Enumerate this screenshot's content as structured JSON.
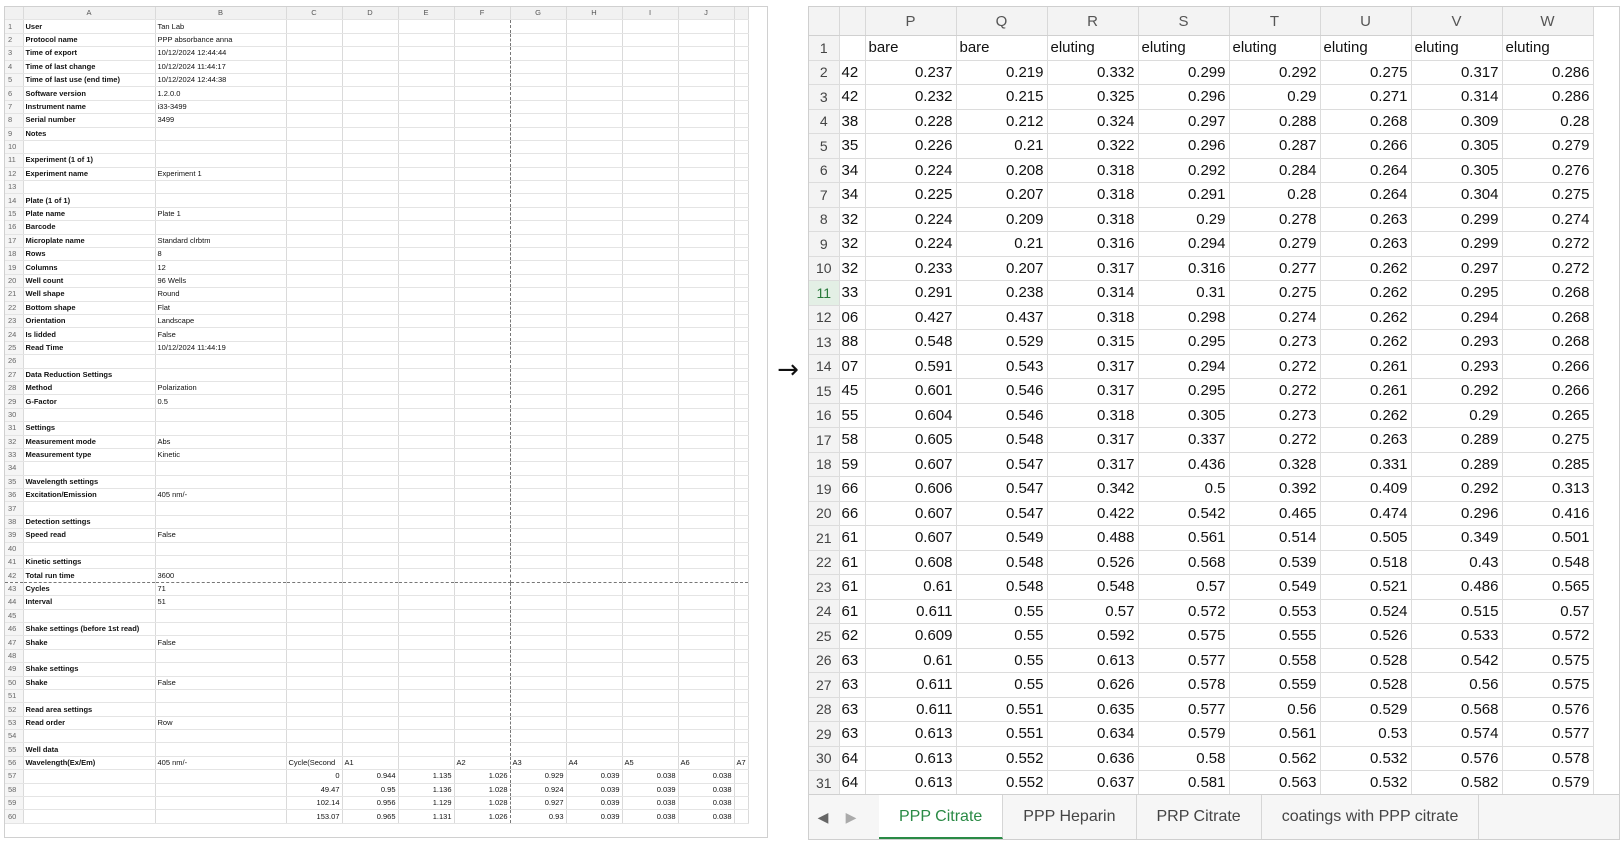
{
  "left_sheet": {
    "columns": [
      "A",
      "B",
      "C",
      "D",
      "E",
      "F",
      "G",
      "H",
      "I",
      "J"
    ],
    "rows": [
      {
        "n": "1",
        "a": "User",
        "b": "Tan Lab"
      },
      {
        "n": "2",
        "a": "Protocol name",
        "b": "PPP absorbance anna"
      },
      {
        "n": "3",
        "a": "Time of export",
        "b": "10/12/2024 12:44:44"
      },
      {
        "n": "4",
        "a": "Time of last change",
        "b": "10/12/2024 11:44:17"
      },
      {
        "n": "5",
        "a": "Time of last use (end time)",
        "b": "10/12/2024 12:44:38"
      },
      {
        "n": "6",
        "a": "Software version",
        "b": "1.2.0.0"
      },
      {
        "n": "7",
        "a": "Instrument name",
        "b": "i33-3499"
      },
      {
        "n": "8",
        "a": "Serial number",
        "b": "3499"
      },
      {
        "n": "9",
        "a": "Notes",
        "b": ""
      },
      {
        "n": "10",
        "a": "",
        "b": ""
      },
      {
        "n": "11",
        "a": "Experiment (1 of 1)",
        "b": ""
      },
      {
        "n": "12",
        "a": "Experiment name",
        "b": "Experiment 1"
      },
      {
        "n": "13",
        "a": "",
        "b": ""
      },
      {
        "n": "14",
        "a": "Plate (1 of 1)",
        "b": ""
      },
      {
        "n": "15",
        "a": "Plate name",
        "b": "Plate 1"
      },
      {
        "n": "16",
        "a": "Barcode",
        "b": ""
      },
      {
        "n": "17",
        "a": "Microplate name",
        "b": "Standard clrbtm"
      },
      {
        "n": "18",
        "a": "Rows",
        "b": "8"
      },
      {
        "n": "19",
        "a": "Columns",
        "b": "12"
      },
      {
        "n": "20",
        "a": "Well count",
        "b": "96 Wells"
      },
      {
        "n": "21",
        "a": "Well shape",
        "b": "Round"
      },
      {
        "n": "22",
        "a": "Bottom shape",
        "b": "Flat"
      },
      {
        "n": "23",
        "a": "Orientation",
        "b": "Landscape"
      },
      {
        "n": "24",
        "a": "Is lidded",
        "b": "False"
      },
      {
        "n": "25",
        "a": "Read Time",
        "b": "10/12/2024 11:44:19"
      },
      {
        "n": "26",
        "a": "",
        "b": ""
      },
      {
        "n": "27",
        "a": "Data Reduction Settings",
        "b": ""
      },
      {
        "n": "28",
        "a": "Method",
        "b": "Polarization"
      },
      {
        "n": "29",
        "a": "G-Factor",
        "b": "0.5"
      },
      {
        "n": "30",
        "a": "",
        "b": ""
      },
      {
        "n": "31",
        "a": "Settings",
        "b": ""
      },
      {
        "n": "32",
        "a": "Measurement mode",
        "b": "Abs"
      },
      {
        "n": "33",
        "a": "Measurement type",
        "b": "Kinetic"
      },
      {
        "n": "34",
        "a": "",
        "b": ""
      },
      {
        "n": "35",
        "a": "Wavelength settings",
        "b": ""
      },
      {
        "n": "36",
        "a": "Excitation/Emission",
        "b": "405 nm/-"
      },
      {
        "n": "37",
        "a": "",
        "b": ""
      },
      {
        "n": "38",
        "a": "Detection settings",
        "b": ""
      },
      {
        "n": "39",
        "a": "Speed read",
        "b": "False"
      },
      {
        "n": "40",
        "a": "",
        "b": ""
      },
      {
        "n": "41",
        "a": "Kinetic settings",
        "b": ""
      },
      {
        "n": "42",
        "a": "Total run time",
        "b": "3600"
      },
      {
        "n": "43",
        "a": "Cycles",
        "b": "71"
      },
      {
        "n": "44",
        "a": "Interval",
        "b": "51"
      },
      {
        "n": "45",
        "a": "",
        "b": ""
      },
      {
        "n": "46",
        "a": "Shake settings (before 1st read)",
        "b": ""
      },
      {
        "n": "47",
        "a": "Shake",
        "b": "False"
      },
      {
        "n": "48",
        "a": "",
        "b": ""
      },
      {
        "n": "49",
        "a": "Shake settings",
        "b": ""
      },
      {
        "n": "50",
        "a": "Shake",
        "b": "False"
      },
      {
        "n": "51",
        "a": "",
        "b": ""
      },
      {
        "n": "52",
        "a": "Read area settings",
        "b": ""
      },
      {
        "n": "53",
        "a": "Read order",
        "b": "Row"
      },
      {
        "n": "54",
        "a": "",
        "b": ""
      },
      {
        "n": "55",
        "a": "Well data",
        "b": ""
      },
      {
        "n": "56",
        "a": "Wavelength(Ex/Em)",
        "b": "405 nm/-",
        "c": "Cycle(Second",
        "d": "A1",
        "e": "",
        "f": "A2",
        "g": "A3",
        "h": "A4",
        "i": "A5",
        "j": "A6",
        "k": "A7"
      }
    ],
    "data_rows": [
      {
        "n": "57",
        "c": "0",
        "d": "0.944",
        "e": "1.135",
        "f": "1.026",
        "g": "0.929",
        "h": "0.039",
        "i": "0.038",
        "j": "0.038"
      },
      {
        "n": "58",
        "c": "49.47",
        "d": "0.95",
        "e": "1.136",
        "f": "1.028",
        "g": "0.924",
        "h": "0.039",
        "i": "0.039",
        "j": "0.038"
      },
      {
        "n": "59",
        "c": "102.14",
        "d": "0.956",
        "e": "1.129",
        "f": "1.028",
        "g": "0.927",
        "h": "0.039",
        "i": "0.038",
        "j": "0.038"
      },
      {
        "n": "60",
        "c": "153.07",
        "d": "0.965",
        "e": "1.131",
        "f": "1.026",
        "g": "0.93",
        "h": "0.039",
        "i": "0.038",
        "j": "0.038"
      }
    ]
  },
  "arrow": "→",
  "right_sheet": {
    "columns": [
      "P",
      "Q",
      "R",
      "S",
      "T",
      "U",
      "V",
      "W"
    ],
    "header_row": {
      "n": "1",
      "cells": [
        "bare",
        "bare",
        "eluting",
        "eluting",
        "eluting",
        "eluting",
        "eluting",
        "eluting"
      ]
    },
    "rows": [
      {
        "n": "2",
        "cut": "42",
        "v": [
          "0.237",
          "0.219",
          "0.332",
          "0.299",
          "0.292",
          "0.275",
          "0.317",
          "0.286"
        ]
      },
      {
        "n": "3",
        "cut": "42",
        "v": [
          "0.232",
          "0.215",
          "0.325",
          "0.296",
          "0.29",
          "0.271",
          "0.314",
          "0.286"
        ]
      },
      {
        "n": "4",
        "cut": "38",
        "v": [
          "0.228",
          "0.212",
          "0.324",
          "0.297",
          "0.288",
          "0.268",
          "0.309",
          "0.28"
        ]
      },
      {
        "n": "5",
        "cut": "35",
        "v": [
          "0.226",
          "0.21",
          "0.322",
          "0.296",
          "0.287",
          "0.266",
          "0.305",
          "0.279"
        ]
      },
      {
        "n": "6",
        "cut": "34",
        "v": [
          "0.224",
          "0.208",
          "0.318",
          "0.292",
          "0.284",
          "0.264",
          "0.305",
          "0.276"
        ]
      },
      {
        "n": "7",
        "cut": "34",
        "v": [
          "0.225",
          "0.207",
          "0.318",
          "0.291",
          "0.28",
          "0.264",
          "0.304",
          "0.275"
        ]
      },
      {
        "n": "8",
        "cut": "32",
        "v": [
          "0.224",
          "0.209",
          "0.318",
          "0.29",
          "0.278",
          "0.263",
          "0.299",
          "0.274"
        ]
      },
      {
        "n": "9",
        "cut": "32",
        "v": [
          "0.224",
          "0.21",
          "0.316",
          "0.294",
          "0.279",
          "0.263",
          "0.299",
          "0.272"
        ]
      },
      {
        "n": "10",
        "cut": "32",
        "v": [
          "0.233",
          "0.207",
          "0.317",
          "0.316",
          "0.277",
          "0.262",
          "0.297",
          "0.272"
        ]
      },
      {
        "n": "11",
        "cut": "33",
        "v": [
          "0.291",
          "0.238",
          "0.314",
          "0.31",
          "0.275",
          "0.262",
          "0.295",
          "0.268"
        ],
        "selected": true
      },
      {
        "n": "12",
        "cut": "06",
        "v": [
          "0.427",
          "0.437",
          "0.318",
          "0.298",
          "0.274",
          "0.262",
          "0.294",
          "0.268"
        ]
      },
      {
        "n": "13",
        "cut": "88",
        "v": [
          "0.548",
          "0.529",
          "0.315",
          "0.295",
          "0.273",
          "0.262",
          "0.293",
          "0.268"
        ]
      },
      {
        "n": "14",
        "cut": "07",
        "v": [
          "0.591",
          "0.543",
          "0.317",
          "0.294",
          "0.272",
          "0.261",
          "0.293",
          "0.266"
        ]
      },
      {
        "n": "15",
        "cut": "45",
        "v": [
          "0.601",
          "0.546",
          "0.317",
          "0.295",
          "0.272",
          "0.261",
          "0.292",
          "0.266"
        ]
      },
      {
        "n": "16",
        "cut": "55",
        "v": [
          "0.604",
          "0.546",
          "0.318",
          "0.305",
          "0.273",
          "0.262",
          "0.29",
          "0.265"
        ]
      },
      {
        "n": "17",
        "cut": "58",
        "v": [
          "0.605",
          "0.548",
          "0.317",
          "0.337",
          "0.272",
          "0.263",
          "0.289",
          "0.275"
        ]
      },
      {
        "n": "18",
        "cut": "59",
        "v": [
          "0.607",
          "0.547",
          "0.317",
          "0.436",
          "0.328",
          "0.331",
          "0.289",
          "0.285"
        ]
      },
      {
        "n": "19",
        "cut": "66",
        "v": [
          "0.606",
          "0.547",
          "0.342",
          "0.5",
          "0.392",
          "0.409",
          "0.292",
          "0.313"
        ]
      },
      {
        "n": "20",
        "cut": "66",
        "v": [
          "0.607",
          "0.547",
          "0.422",
          "0.542",
          "0.465",
          "0.474",
          "0.296",
          "0.416"
        ]
      },
      {
        "n": "21",
        "cut": "61",
        "v": [
          "0.607",
          "0.549",
          "0.488",
          "0.561",
          "0.514",
          "0.505",
          "0.349",
          "0.501"
        ]
      },
      {
        "n": "22",
        "cut": "61",
        "v": [
          "0.608",
          "0.548",
          "0.526",
          "0.568",
          "0.539",
          "0.518",
          "0.43",
          "0.548"
        ]
      },
      {
        "n": "23",
        "cut": "61",
        "v": [
          "0.61",
          "0.548",
          "0.548",
          "0.57",
          "0.549",
          "0.521",
          "0.486",
          "0.565"
        ]
      },
      {
        "n": "24",
        "cut": "61",
        "v": [
          "0.611",
          "0.55",
          "0.57",
          "0.572",
          "0.553",
          "0.524",
          "0.515",
          "0.57"
        ]
      },
      {
        "n": "25",
        "cut": "62",
        "v": [
          "0.609",
          "0.55",
          "0.592",
          "0.575",
          "0.555",
          "0.526",
          "0.533",
          "0.572"
        ]
      },
      {
        "n": "26",
        "cut": "63",
        "v": [
          "0.61",
          "0.55",
          "0.613",
          "0.577",
          "0.558",
          "0.528",
          "0.542",
          "0.575"
        ]
      },
      {
        "n": "27",
        "cut": "63",
        "v": [
          "0.611",
          "0.55",
          "0.626",
          "0.578",
          "0.559",
          "0.528",
          "0.56",
          "0.575"
        ]
      },
      {
        "n": "28",
        "cut": "63",
        "v": [
          "0.611",
          "0.551",
          "0.635",
          "0.577",
          "0.56",
          "0.529",
          "0.568",
          "0.576"
        ]
      },
      {
        "n": "29",
        "cut": "63",
        "v": [
          "0.613",
          "0.551",
          "0.634",
          "0.579",
          "0.561",
          "0.53",
          "0.574",
          "0.577"
        ]
      },
      {
        "n": "30",
        "cut": "64",
        "v": [
          "0.613",
          "0.552",
          "0.636",
          "0.58",
          "0.562",
          "0.532",
          "0.576",
          "0.578"
        ]
      },
      {
        "n": "31",
        "cut": "64",
        "v": [
          "0.613",
          "0.552",
          "0.637",
          "0.581",
          "0.563",
          "0.532",
          "0.582",
          "0.579"
        ]
      }
    ],
    "tabs": [
      {
        "label": "PPP Citrate",
        "active": true
      },
      {
        "label": "PPP Heparin",
        "active": false
      },
      {
        "label": "PRP Citrate",
        "active": false
      },
      {
        "label": "coatings with PPP citrate",
        "active": false
      }
    ],
    "nav": {
      "prev": "◀",
      "next": "▶"
    },
    "accent_color": "#2a8a45"
  }
}
